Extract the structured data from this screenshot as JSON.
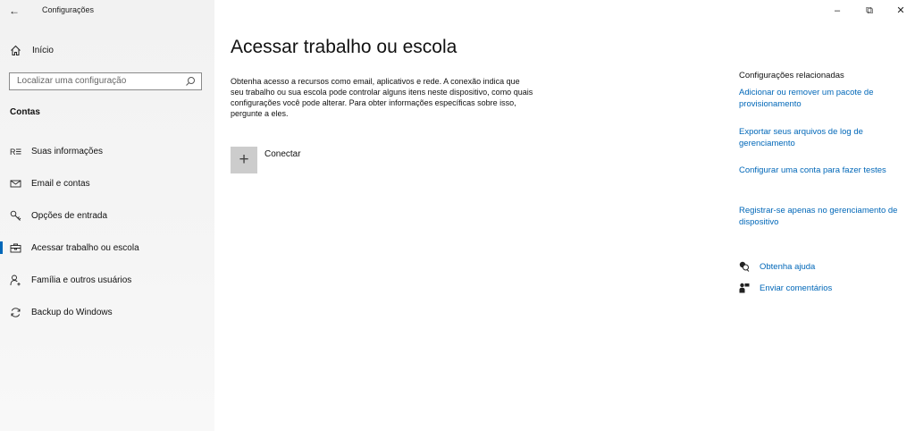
{
  "window": {
    "title": "Configurações",
    "back_glyph": "←",
    "minimize_glyph": "–",
    "restore_glyph": "⧉",
    "close_glyph": "✕"
  },
  "sidebar": {
    "home_label": "Início",
    "home_icon": "home-icon",
    "search": {
      "placeholder": "Localizar uma configuração",
      "icon": "search-icon"
    },
    "section_title": "Contas",
    "items": [
      {
        "label": "Suas informações",
        "icon": "person-list-icon",
        "selected": false
      },
      {
        "label": "Email e contas",
        "icon": "mail-icon",
        "selected": false
      },
      {
        "label": "Opções de entrada",
        "icon": "key-icon",
        "selected": false
      },
      {
        "label": "Acessar trabalho ou escola",
        "icon": "briefcase-icon",
        "selected": true
      },
      {
        "label": "Família e outros usuários",
        "icon": "add-person-icon",
        "selected": false
      },
      {
        "label": "Backup do Windows",
        "icon": "sync-icon",
        "selected": false
      }
    ],
    "accent_color": "#0067b8"
  },
  "main": {
    "title": "Acessar trabalho ou escola",
    "description": "Obtenha acesso a recursos como email, aplicativos e rede. A conexão indica que seu trabalho ou sua escola pode controlar alguns itens neste dispositivo, como quais configurações você pode alterar. Para obter informações específicas sobre isso, pergunte a eles.",
    "connect": {
      "label": "Conectar",
      "icon_glyph": "+"
    }
  },
  "related": {
    "title": "Configurações relacionadas",
    "links": [
      "Adicionar ou remover um pacote de provisionamento",
      "Exportar seus arquivos de log de gerenciamento",
      "Configurar uma conta para fazer testes",
      "Registrar-se apenas no gerenciamento de dispositivo"
    ],
    "help": [
      {
        "label": "Obtenha ajuda",
        "icon": "help-chat-icon"
      },
      {
        "label": "Enviar comentários",
        "icon": "feedback-icon"
      }
    ],
    "link_color": "#0067b8"
  }
}
